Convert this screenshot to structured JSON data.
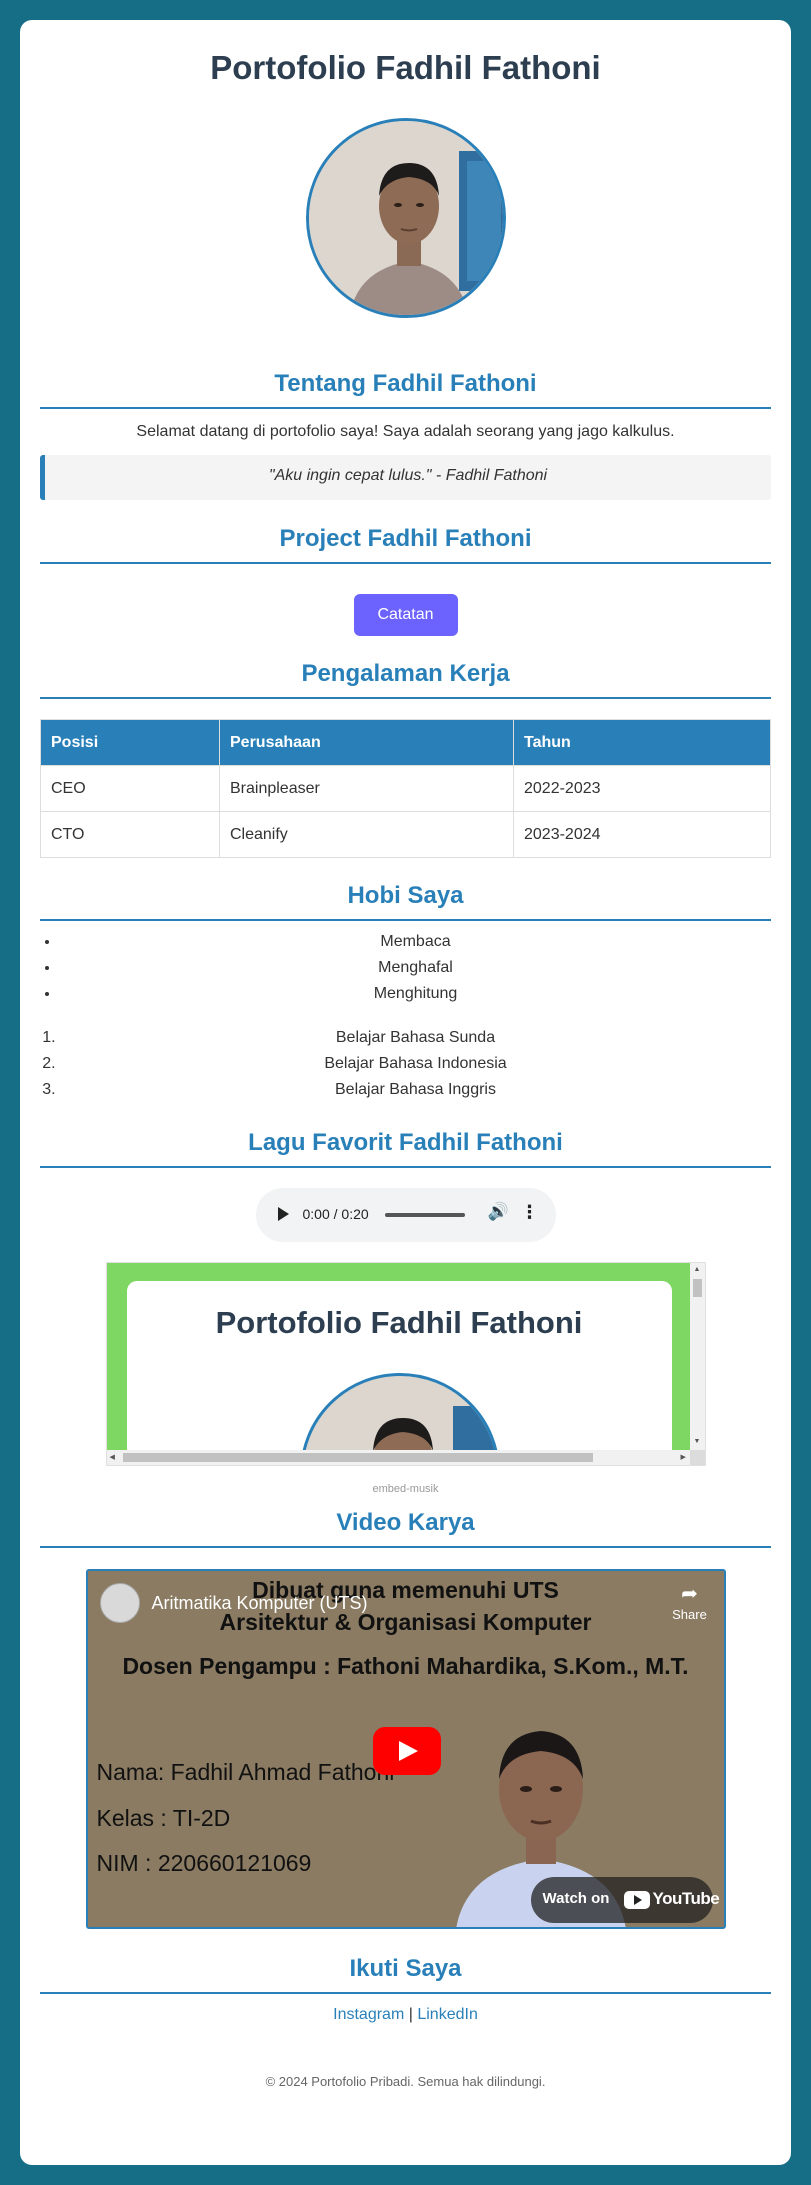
{
  "title": "Portofolio Fadhil Fathoni",
  "about": {
    "heading": "Tentang Fadhil Fathoni",
    "text": "Selamat datang di portofolio saya! Saya adalah seorang yang jago kalkulus.",
    "quote": "\"Aku ingin cepat lulus.\" - Fadhil Fathoni"
  },
  "project": {
    "heading": "Project Fadhil Fathoni",
    "button_label": "Catatan"
  },
  "experience": {
    "heading": "Pengalaman Kerja",
    "columns": [
      "Posisi",
      "Perusahaan",
      "Tahun"
    ],
    "rows": [
      [
        "CEO",
        "Brainpleaser",
        "2022-2023"
      ],
      [
        "CTO",
        "Cleanify",
        "2023-2024"
      ]
    ]
  },
  "hobbies": {
    "heading": "Hobi Saya",
    "bullets": [
      "Membaca",
      "Menghafal",
      "Menghitung"
    ],
    "numbered": [
      "Belajar Bahasa Sunda",
      "Belajar Bahasa Indonesia",
      "Belajar Bahasa Inggris"
    ]
  },
  "music": {
    "heading": "Lagu Favorit Fadhil Fathoni",
    "audio_time": "0:00 / 0:20",
    "embed_title": "Portofolio Fadhil Fathoni",
    "embed_caption": "embed-musik"
  },
  "video": {
    "heading": "Video Karya",
    "channel_title": "Aritmatika Komputer (UTS)",
    "share_label": "Share",
    "watch_on": "Watch on",
    "youtube_label": "YouTube",
    "line1": "Dibuat guna memenuhi UTS",
    "line2": "Arsitektur & Organisasi Komputer",
    "line3": "Dosen Pengampu : Fathoni Mahardika, S.Kom., M.T.",
    "nama": "Nama: Fadhil Ahmad Fathoni",
    "kelas": "Kelas : TI-2D",
    "nim": "NIM : 220660121069"
  },
  "social": {
    "heading": "Ikuti Saya",
    "instagram": "Instagram",
    "separator": "|",
    "linkedin": "LinkedIn"
  },
  "footer": "© 2024 Portofolio Pribadi. Semua hak dilindungi.",
  "colors": {
    "background": "#166e86",
    "accent": "#2980b9",
    "title": "#2c3e50",
    "button": "#6c63ff"
  }
}
